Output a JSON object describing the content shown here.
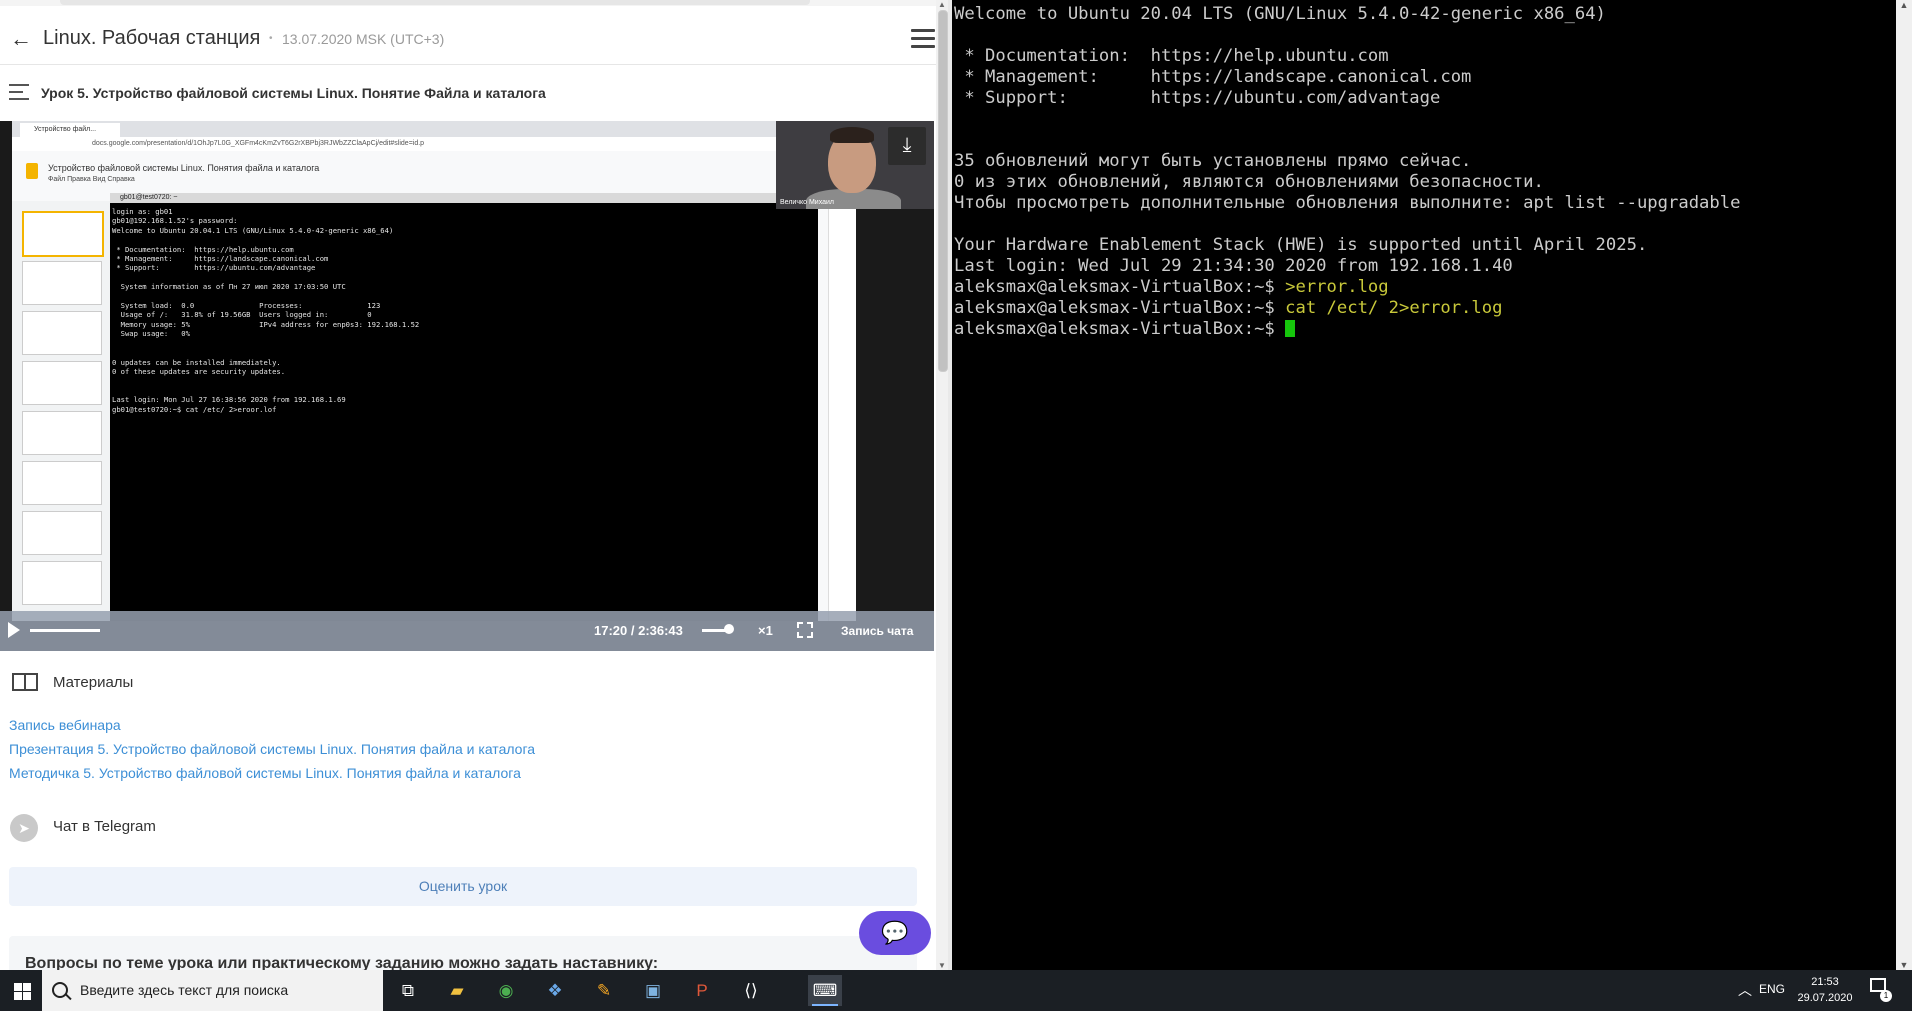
{
  "page": {
    "course_title": "Linux. Рабочая станция",
    "separator": "•",
    "date": "13.07.2020 MSK (UTC+3)",
    "lesson_title": "Урок 5. Устройство файловой системы Linux. Понятие Файла и каталога"
  },
  "video": {
    "recorded_tab": "Устройство файл...",
    "recorded_url": "docs.google.com/presentation/d/1OhJp7L0G_XGFm4cKmZvT6G2rXBPbj3RJWbZZClaApCj/edit#slide=id.p",
    "recorded_doc_title": "Устройство файловой системы Linux. Понятия файла и каталога",
    "recorded_doc_menu": "Файл   Правка   Вид   Справка",
    "recorded_terminal_title": "gb01@test0720: ~",
    "recorded_terminal_text": "login as: gb01\ngb01@192.168.1.52's password:\nWelcome to Ubuntu 20.04.1 LTS (GNU/Linux 5.4.0-42-generic x86_64)\n\n * Documentation:  https://help.ubuntu.com\n * Management:     https://landscape.canonical.com\n * Support:        https://ubuntu.com/advantage\n\n  System information as of Пн 27 июл 2020 17:03:50 UTC\n\n  System load:  0.0               Processes:               123\n  Usage of /:   31.8% of 19.56GB  Users logged in:         0\n  Memory usage: 5%                IPv4 address for enp0s3: 192.168.1.52\n  Swap usage:   0%\n\n\n0 updates can be installed immediately.\n0 of these updates are security updates.\n\n\nLast login: Mon Jul 27 16:38:56 2020 from 192.168.1.69\ngb01@test0720:~$ cat /etc/ 2>eroor.lof",
    "presenter_name": "Величко Михаил",
    "time": "17:20 / 2:36:43",
    "progress_fraction": 0.11,
    "speed": "×1",
    "chat_record_label": "Запись чата"
  },
  "materials": {
    "title": "Материалы",
    "links": [
      "Запись вебинара",
      "Презентация 5. Устройство файловой системы Linux. Понятия файла и каталога",
      "Методичка 5. Устройство файловой системы Linux. Понятия файла и каталога"
    ]
  },
  "telegram": {
    "title": "Чат в Telegram"
  },
  "rate_button": "Оценить урок",
  "question_text": "Вопросы по теме урока или практическому заданию можно задать наставнику:",
  "terminal": {
    "lines": [
      "Welcome to Ubuntu 20.04 LTS (GNU/Linux 5.4.0-42-generic x86_64)",
      "",
      " * Documentation:  https://help.ubuntu.com",
      " * Management:     https://landscape.canonical.com",
      " * Support:        https://ubuntu.com/advantage",
      "",
      "",
      "35 обновлений могут быть установлены прямо сейчас.",
      "0 из этих обновлений, являются обновлениями безопасности.",
      "Чтобы просмотреть дополнительные обновления выполните: apt list --upgradable",
      "",
      "Your Hardware Enablement Stack (HWE) is supported until April 2025.",
      "Last login: Wed Jul 29 21:34:30 2020 from 192.168.1.40"
    ],
    "prompt": "aleksmax@aleksmax-VirtualBox:~$ ",
    "commands": [
      ">error.log",
      "cat /ect/ 2>error.log"
    ]
  },
  "taskbar": {
    "search_placeholder": "Введите здесь текст для поиска",
    "language": "ENG",
    "time": "21:53",
    "date": "29.07.2020",
    "notifications": "1",
    "apps": [
      "task-view-icon",
      "file-explorer-icon",
      "chrome-icon",
      "virtualbox-icon",
      "paint-icon",
      "photos-icon",
      "powerpoint-icon",
      "code-editor-icon",
      "putty-icon"
    ]
  },
  "colors": {
    "accent_link": "#3d8fd6",
    "chat_button": "#6a4ddf",
    "terminal_command": "#c8c83a",
    "cursor": "#16c60c"
  }
}
